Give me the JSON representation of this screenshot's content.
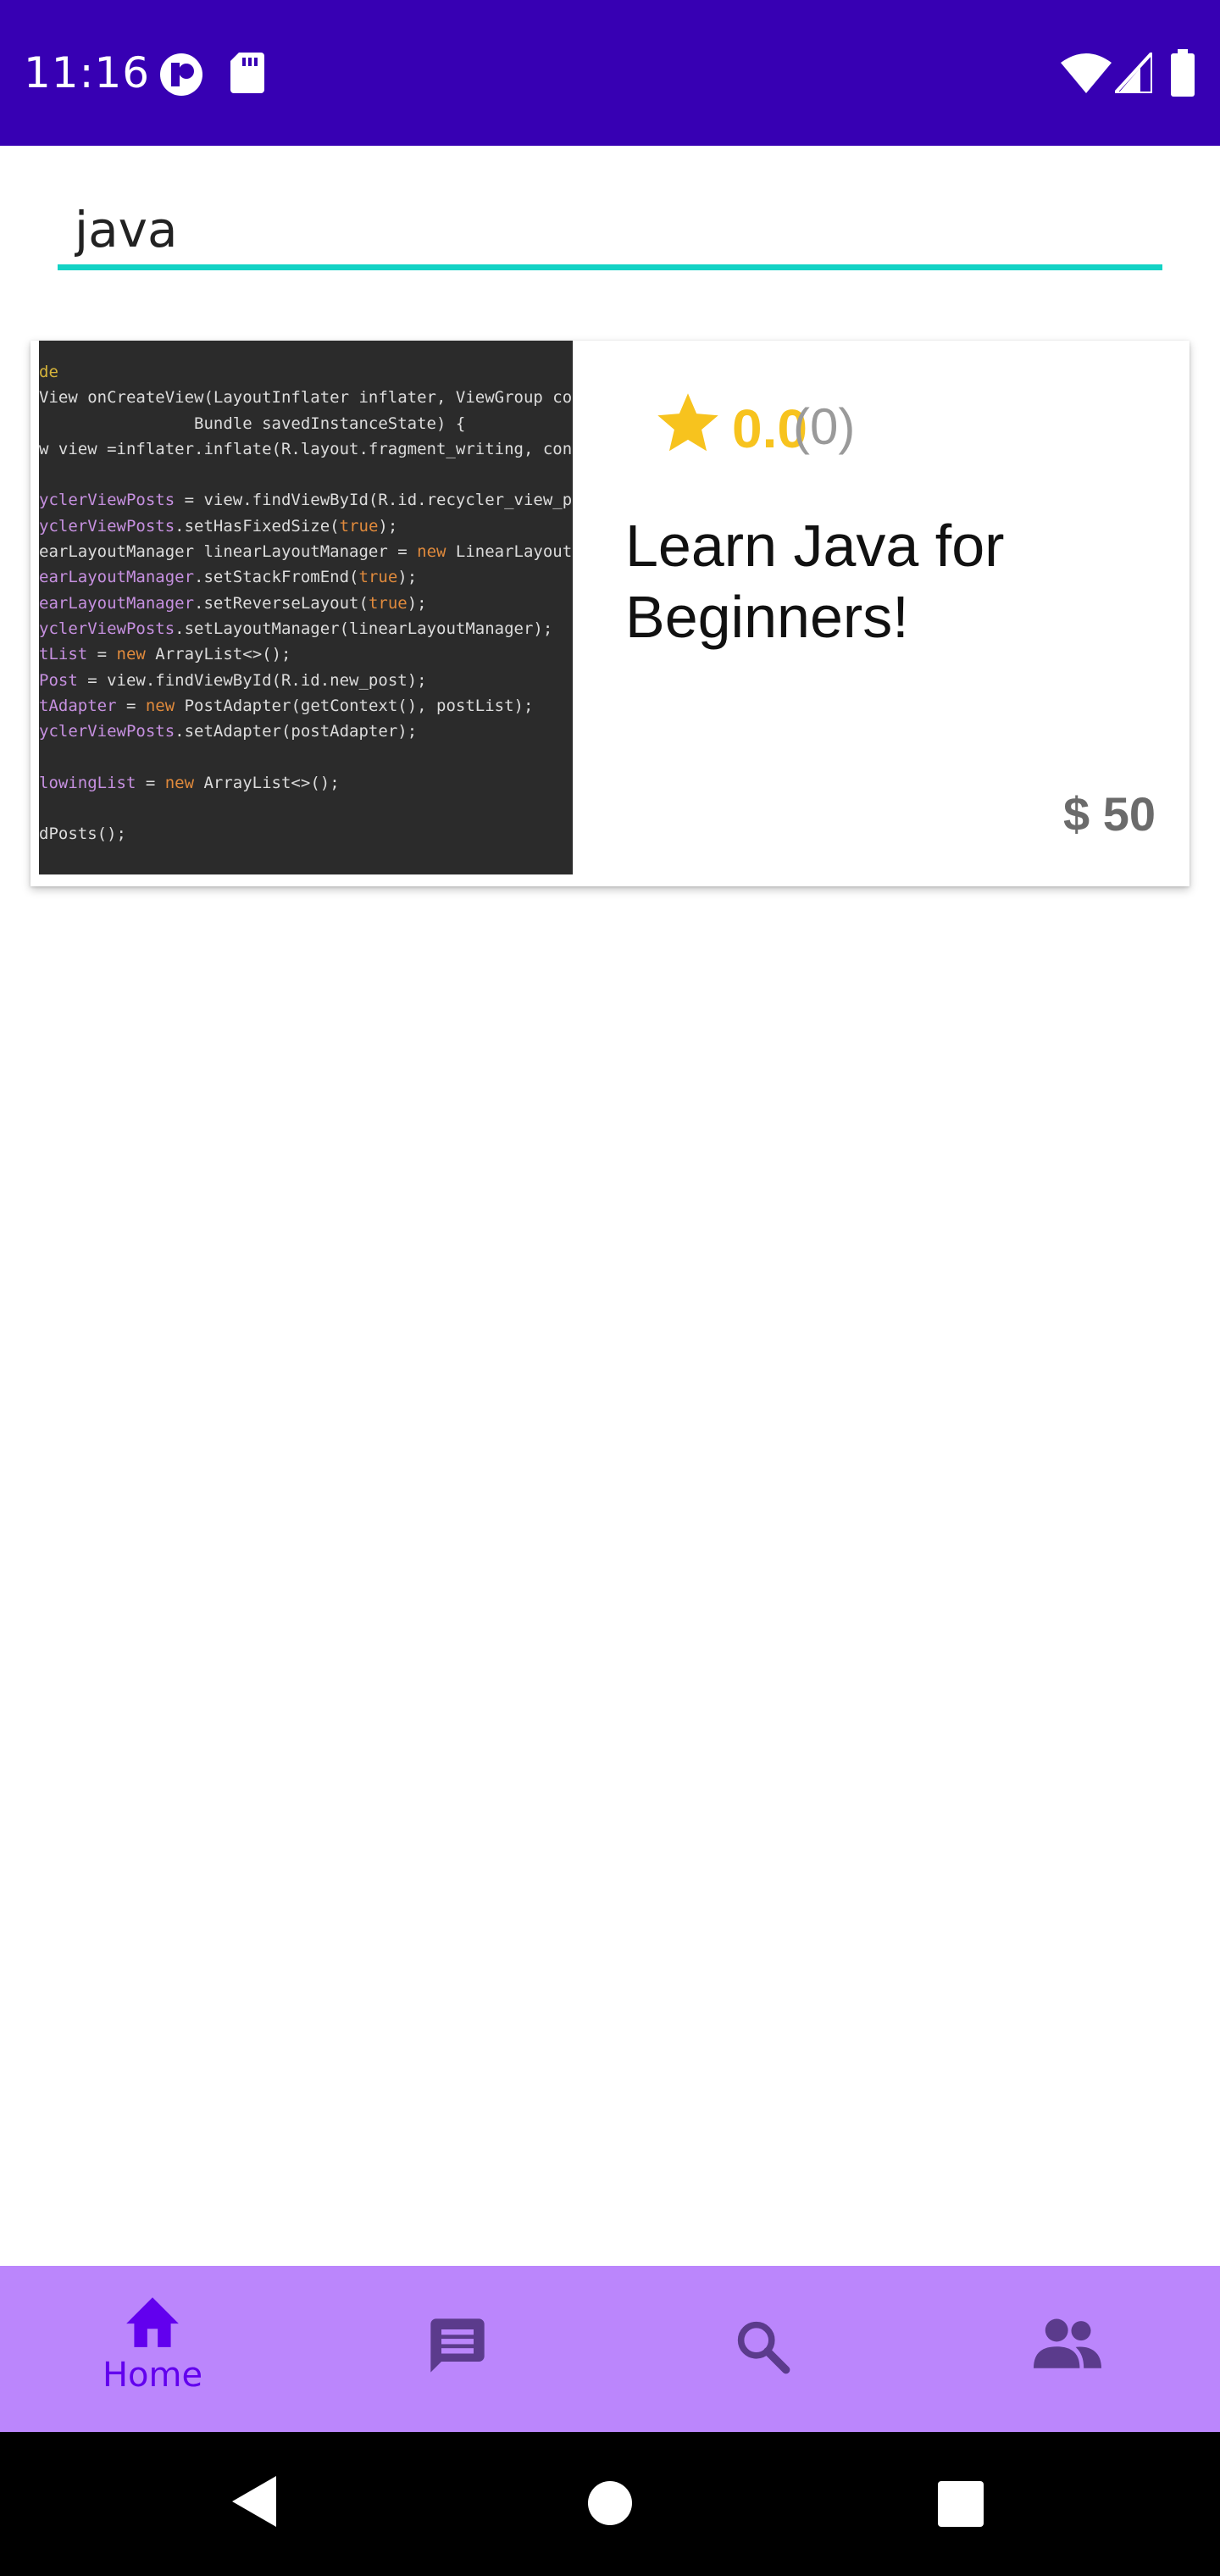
{
  "status_bar": {
    "time": "11:16",
    "icons": [
      "notification-app-icon",
      "sd-card-icon",
      "wifi-icon",
      "cellular-signal-icon",
      "battery-icon"
    ],
    "background": "#3700b3"
  },
  "search": {
    "value": "java",
    "underline_color": "#13d3c5"
  },
  "results": [
    {
      "thumbnail": {
        "icon": "code-screenshot-image",
        "code_lines": [
          "de",
          "View onCreateView(LayoutInflater inflater, ViewGroup co",
          "                Bundle savedInstanceState) {",
          "w view =inflater.inflate(R.layout.fragment_writing, con",
          "",
          "yclerViewPosts = view.findViewById(R.id.recycler_view_p",
          "yclerViewPosts.setHasFixedSize(true);",
          "earLayoutManager linearLayoutManager = new LinearLayout",
          "earLayoutManager.setStackFromEnd(true);",
          "earLayoutManager.setReverseLayout(true);",
          "yclerViewPosts.setLayoutManager(linearLayoutManager);",
          "tList = new ArrayList<>();",
          "Post = view.findViewById(R.id.new_post);",
          "tAdapter = new PostAdapter(getContext(), postList);",
          "yclerViewPosts.setAdapter(postAdapter);",
          "",
          "lowingList = new ArrayList<>();",
          "",
          "dPosts();"
        ]
      },
      "rating": "0.0",
      "rating_count": "(0)",
      "title": "Learn Java for Beginners!",
      "price": "$ 50"
    }
  ],
  "bottom_nav": {
    "items": [
      {
        "icon": "home-icon",
        "label": "Home",
        "selected": true
      },
      {
        "icon": "chat-icon",
        "label": "",
        "selected": false
      },
      {
        "icon": "search-icon",
        "label": "",
        "selected": false
      },
      {
        "icon": "people-icon",
        "label": "",
        "selected": false
      }
    ],
    "background": "#bb86fc",
    "active_color": "#6200ee",
    "inactive_color": "#5b3b8c"
  },
  "system_nav": {
    "buttons": [
      "back-icon",
      "home-circle-icon",
      "recents-icon"
    ]
  },
  "colors": {
    "star": "#f7c31e",
    "rating_count": "#9a9a9a",
    "price": "#6b6b6b"
  }
}
